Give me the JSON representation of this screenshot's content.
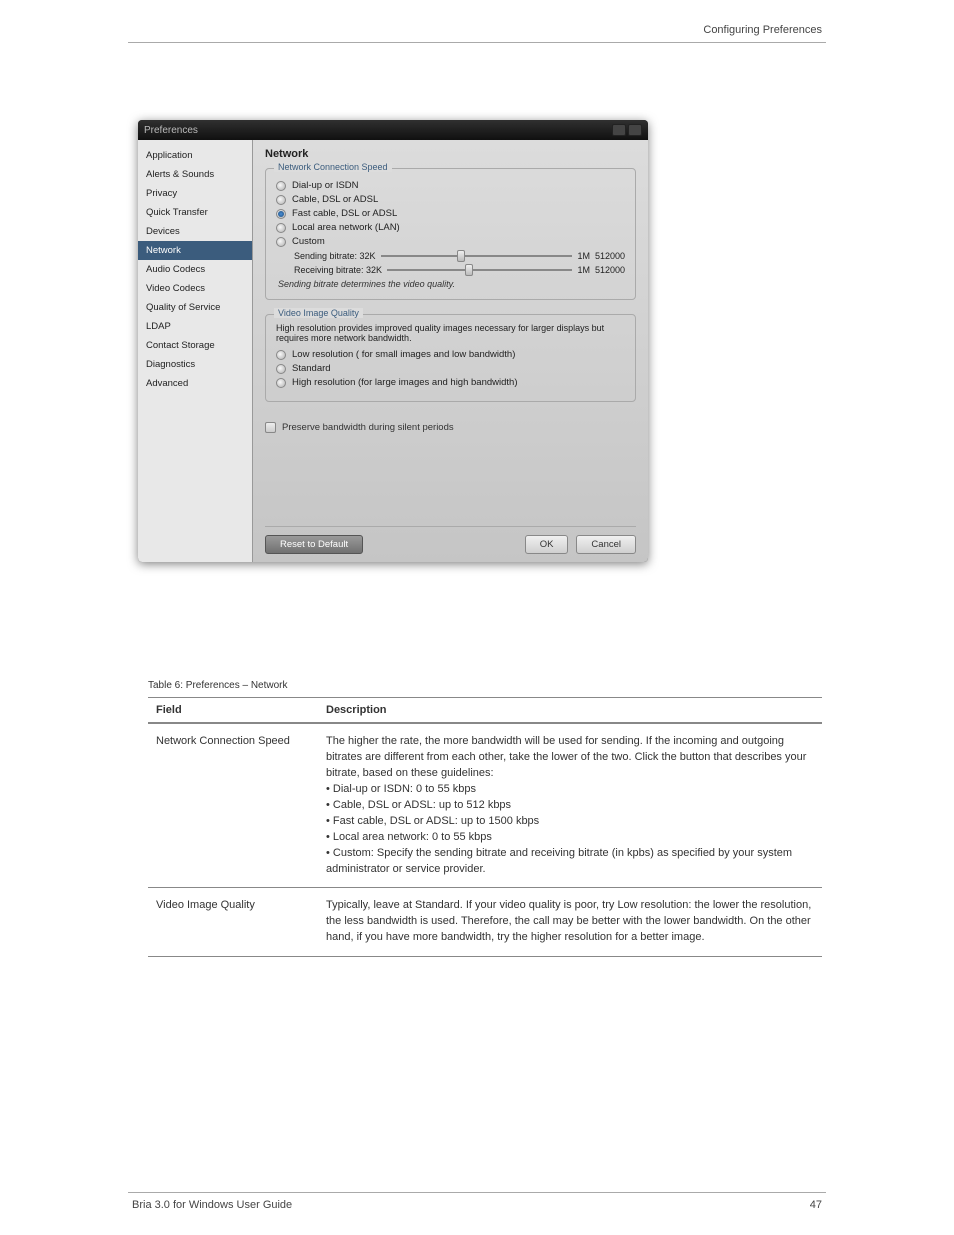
{
  "header": {
    "right": "Configuring Preferences"
  },
  "footer": {
    "left": "Bria 3.0 for Windows User Guide",
    "right": "47"
  },
  "prefs_window": {
    "title": "Preferences",
    "sidebar": {
      "items": [
        {
          "label": "Application"
        },
        {
          "label": "Alerts & Sounds"
        },
        {
          "label": "Privacy"
        },
        {
          "label": "Quick Transfer"
        },
        {
          "label": "Devices"
        },
        {
          "label": "Network",
          "active": true
        },
        {
          "label": "Audio Codecs"
        },
        {
          "label": "Video Codecs"
        },
        {
          "label": "Quality of Service"
        },
        {
          "label": "LDAP"
        },
        {
          "label": "Contact Storage"
        },
        {
          "label": "Diagnostics"
        },
        {
          "label": "Advanced"
        }
      ]
    },
    "main": {
      "heading": "Network",
      "group_speed": {
        "legend": "Network Connection Speed",
        "options": {
          "dialup": "Dial-up or ISDN",
          "cable": "Cable, DSL or ADSL",
          "fast": "Fast cable, DSL or ADSL",
          "lan": "Local area network (LAN)",
          "custom": "Custom"
        },
        "sliders": {
          "send_label": "Sending bitrate: 32K",
          "recv_label": "Receiving bitrate: 32K",
          "scale_right": "1M",
          "send_value": "512000",
          "recv_value": "512000"
        },
        "hint": "Sending bitrate determines the video quality."
      },
      "group_video": {
        "legend": "Video Image Quality",
        "desc": "High resolution provides improved quality images necessary for larger displays but requires more network bandwidth.",
        "options": {
          "low": "Low resolution ( for small images and low bandwidth)",
          "standard": "Standard",
          "high": "High resolution (for large images and high bandwidth)"
        }
      },
      "preserve_bw": "Preserve bandwidth during silent periods",
      "buttons": {
        "reset": "Reset to Default",
        "ok": "OK",
        "cancel": "Cancel"
      }
    }
  },
  "table": {
    "caption": "Table 6: Preferences – Network",
    "headers": {
      "field": "Field",
      "description": "Description"
    },
    "rows": [
      {
        "field": "Network Connection Speed",
        "description": "The higher the rate, the more bandwidth will be used for sending. If the incoming and outgoing bitrates are different from each other, take the lower of the two. Click the button that describes your bitrate, based on these guidelines:\n• Dial-up or ISDN: 0 to 55 kbps\n• Cable, DSL or ADSL: up to 512 kbps\n• Fast cable, DSL or ADSL: up to 1500 kbps\n• Local area network: 0 to 55 kbps\n• Custom: Specify the sending bitrate and receiving bitrate (in kpbs) as specified by your system administrator or service provider."
      },
      {
        "field": "Video Image Quality",
        "description": "Typically, leave at Standard. If your video quality is poor, try Low resolution: the lower the resolution, the less bandwidth is used. Therefore, the call may be better with the lower bandwidth. On the other hand, if you have more bandwidth, try the higher resolution for a better image."
      }
    ]
  }
}
